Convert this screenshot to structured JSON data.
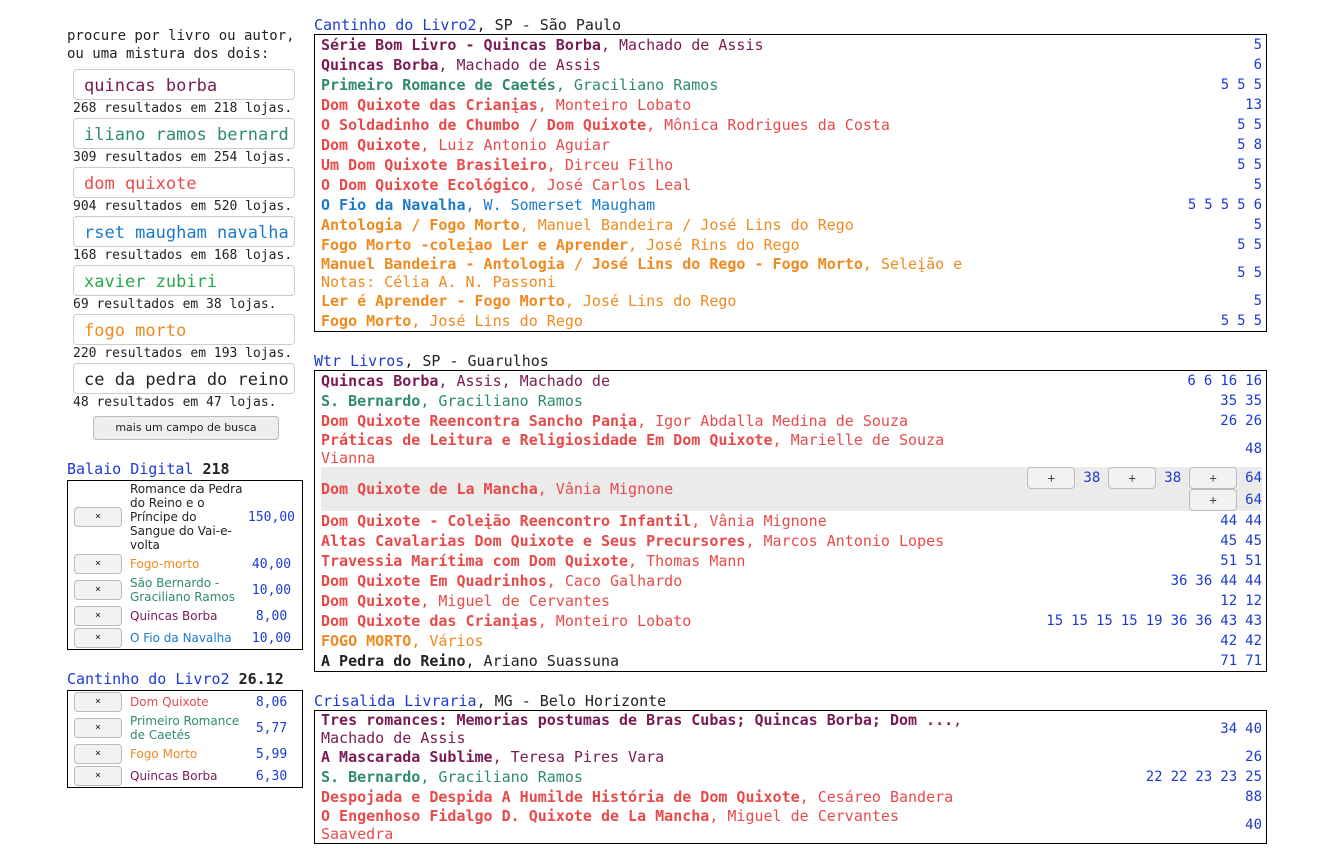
{
  "search": {
    "intro": "procure por livro ou autor, ou uma mistura dos dois:",
    "fields": [
      {
        "value": "quincas borba",
        "color": "#7a1a52",
        "result": "268 resultados em 218 lojas."
      },
      {
        "value": "iliano ramos bernard",
        "color": "#2e8b6a",
        "result": "309 resultados em 254 lojas."
      },
      {
        "value": "dom quixote",
        "color": "#e84a4a",
        "result": "904 resultados em 520 lojas."
      },
      {
        "value": "rset maugham navalha",
        "color": "#1a7ac9",
        "result": "168 resultados em 168 lojas."
      },
      {
        "value": "xavier zubiri",
        "color": "#2aa84a",
        "result": "69 resultados em 38 lojas."
      },
      {
        "value": "fogo morto",
        "color": "#f08a20",
        "result": "220 resultados em 193 lojas."
      },
      {
        "value": "ce da pedra do reino",
        "color": "#222222",
        "result": "48 resultados em 47 lojas."
      }
    ],
    "more_button": "mais um campo de busca"
  },
  "carts": [
    {
      "store": "Balaio Digital",
      "total": "218",
      "items": [
        {
          "x": "×",
          "title": "Romance da Pedra do Reino e o Príncipe do Sangue do Vai-e-volta",
          "price": "150,00",
          "color": "#222222"
        },
        {
          "x": "×",
          "title": "Fogo-morto",
          "price": "40,00",
          "color": "#f08a20"
        },
        {
          "x": "×",
          "title": "São Bernardo - Graciliano Ramos",
          "price": "10,00",
          "color": "#2e8b6a"
        },
        {
          "x": "×",
          "title": "Quincas Borba",
          "price": "8,00",
          "color": "#7a1a52"
        },
        {
          "x": "×",
          "title": "O Fio da Navalha",
          "price": "10,00",
          "color": "#1a7ac9"
        }
      ]
    },
    {
      "store": "Cantinho do Livro2",
      "total": "26.12",
      "items": [
        {
          "x": "×",
          "title": "Dom Quixote",
          "price": "8,06",
          "color": "#e84a4a"
        },
        {
          "x": "×",
          "title": "Primeiro Romance de Caetés",
          "price": "5,77",
          "color": "#2e8b6a"
        },
        {
          "x": "×",
          "title": "Fogo Morto",
          "price": "5,99",
          "color": "#f08a20"
        },
        {
          "x": "×",
          "title": "Quincas Borba",
          "price": "6,30",
          "color": "#7a1a52"
        }
      ]
    }
  ],
  "shops": [
    {
      "name": "Cantinho do Livro2",
      "loc": ", SP - São Paulo",
      "rows": [
        {
          "t": "Série Bom Livro - Quincas Borba",
          "a": ", Machado de Assis",
          "c": "#7a1a52",
          "p": [
            "5"
          ]
        },
        {
          "t": "Quincas Borba",
          "a": ", Machado de Assis",
          "c": "#7a1a52",
          "p": [
            "6"
          ]
        },
        {
          "t": "Primeiro Romance de Caetés",
          "a": ", Graciliano Ramos",
          "c": "#2e8b6a",
          "p": [
            "5",
            "5",
            "5"
          ]
        },
        {
          "t": "Dom Quixote das Crianįas",
          "a": ", Monteiro Lobato",
          "c": "#e84a4a",
          "p": [
            "13"
          ]
        },
        {
          "t": "O Soldadinho de Chumbo / Dom Quixote",
          "a": ", Mônica Rodrigues da Costa",
          "c": "#e84a4a",
          "p": [
            "5",
            "5"
          ]
        },
        {
          "t": "Dom Quixote",
          "a": ", Luiz Antonio Aguiar",
          "c": "#e84a4a",
          "p": [
            "5",
            "8"
          ]
        },
        {
          "t": "Um Dom Quixote Brasileiro",
          "a": ", Dirceu Filho",
          "c": "#e84a4a",
          "p": [
            "5",
            "5"
          ]
        },
        {
          "t": "O Dom Quixote Ecológico",
          "a": ", José Carlos Leal",
          "c": "#e84a4a",
          "p": [
            "5"
          ]
        },
        {
          "t": "O Fio da Navalha",
          "a": ", W. Somerset Maugham",
          "c": "#1a7ac9",
          "p": [
            "5",
            "5",
            "5",
            "5",
            "6"
          ]
        },
        {
          "t": "Antologia / Fogo Morto",
          "a": ", Manuel Bandeira / José Lins do Rego",
          "c": "#f08a20",
          "p": [
            "5"
          ]
        },
        {
          "t": "Fogo Morto -coleįao Ler e Aprender",
          "a": ", José Rins do Rego",
          "c": "#f08a20",
          "p": [
            "5",
            "5"
          ]
        },
        {
          "t": "Manuel Bandeira - Antologia / José Lins do Rego - Fogo Morto",
          "a": ", Seleįão e Notas: Célia A. N. Passoni",
          "c": "#f08a20",
          "p": [
            "5",
            "5"
          ]
        },
        {
          "t": "Ler é Aprender - Fogo Morto",
          "a": ", José Lins do Rego",
          "c": "#f08a20",
          "p": [
            "5"
          ]
        },
        {
          "t": "Fogo Morto",
          "a": ", José Lins do Rego",
          "c": "#f08a20",
          "p": [
            "5",
            "5",
            "5"
          ]
        }
      ]
    },
    {
      "name": "Wtr Livros",
      "loc": ", SP - Guarulhos",
      "rows": [
        {
          "t": "Quincas Borba",
          "a": ", Assis, Machado de",
          "c": "#7a1a52",
          "p": [
            "6",
            "6",
            "16",
            "16"
          ]
        },
        {
          "t": "S. Bernardo",
          "a": ", Graciliano Ramos",
          "c": "#2e8b6a",
          "p": [
            "35",
            "35"
          ]
        },
        {
          "t": "Dom Quixote Reencontra Sancho Panįa",
          "a": ", Igor Abdalla Medina de Souza",
          "c": "#e84a4a",
          "p": [
            "26",
            "26"
          ]
        },
        {
          "t": "Práticas de Leitura e Religiosidade Em Dom Quixote",
          "a": ", Marielle de Souza Vianna",
          "c": "#e84a4a",
          "p": [
            "48"
          ]
        },
        {
          "t": "Dom Quixote de La Mancha",
          "a": ", Vânia Mignone",
          "c": "#e84a4a",
          "hl": true,
          "pb": true,
          "p": [
            "38",
            "38",
            "64",
            "64"
          ]
        },
        {
          "t": "Dom Quixote - Coleįão Reencontro Infantil",
          "a": ", Vânia Mignone",
          "c": "#e84a4a",
          "p": [
            "44",
            "44"
          ]
        },
        {
          "t": "Altas Cavalarias Dom Quixote e Seus Precursores",
          "a": ", Marcos Antonio Lopes",
          "c": "#e84a4a",
          "p": [
            "45",
            "45"
          ]
        },
        {
          "t": "Travessia Marítima com Dom Quixote",
          "a": ", Thomas Mann",
          "c": "#e84a4a",
          "p": [
            "51",
            "51"
          ]
        },
        {
          "t": "Dom Quixote Em Quadrinhos",
          "a": ", Caco Galhardo",
          "c": "#e84a4a",
          "p": [
            "36",
            "36",
            "44",
            "44"
          ]
        },
        {
          "t": "Dom Quixote",
          "a": ", Miguel de Cervantes",
          "c": "#e84a4a",
          "p": [
            "12",
            "12"
          ]
        },
        {
          "t": "Dom Quixote das Crianįas",
          "a": ", Monteiro Lobato",
          "c": "#e84a4a",
          "p": [
            "15",
            "15",
            "15",
            "15",
            "19",
            "36",
            "36",
            "43",
            "43"
          ]
        },
        {
          "t": "FOGO MORTO",
          "a": ", Vários",
          "c": "#f08a20",
          "p": [
            "42",
            "42"
          ]
        },
        {
          "t": "A Pedra do Reino",
          "a": ", Ariano Suassuna",
          "c": "#222222",
          "p": [
            "71",
            "71"
          ]
        }
      ]
    },
    {
      "name": "Crisalida Livraria",
      "loc": ", MG - Belo Horizonte",
      "rows": [
        {
          "t": "Tres romances: Memorias postumas de Bras Cubas; Quincas Borba; Dom ...",
          "a": ", Machado de Assis",
          "c": "#7a1a52",
          "p": [
            "34",
            "40"
          ]
        },
        {
          "t": "A Mascarada Sublime",
          "a": ", Teresa Pires Vara",
          "c": "#7a1a52",
          "p": [
            "26"
          ]
        },
        {
          "t": "S. Bernardo",
          "a": ", Graciliano Ramos",
          "c": "#2e8b6a",
          "p": [
            "22",
            "22",
            "23",
            "23",
            "25"
          ]
        },
        {
          "t": "Despojada e Despida A Humilde História de Dom Quixote",
          "a": ", Cesáreo Bandera",
          "c": "#e84a4a",
          "p": [
            "88"
          ]
        },
        {
          "t": "O Engenhoso Fidalgo D. Quixote de La Mancha",
          "a": ", Miguel de Cervantes Saavedra",
          "c": "#e84a4a",
          "p": [
            "40"
          ]
        }
      ]
    }
  ]
}
